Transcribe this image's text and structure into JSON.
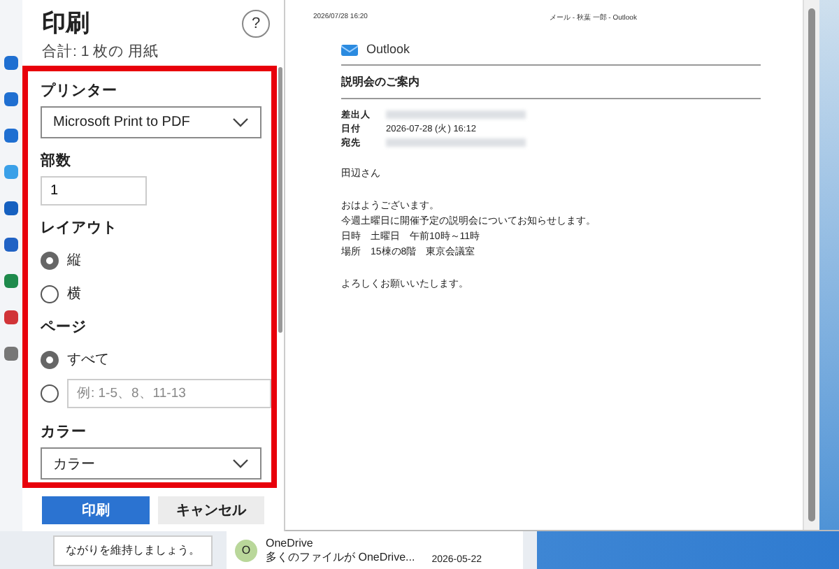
{
  "dialog": {
    "title": "印刷",
    "subtitle": "合計: 1 枚の 用紙",
    "help": "?"
  },
  "printer": {
    "label": "プリンター",
    "value": "Microsoft Print to PDF"
  },
  "copies": {
    "label": "部数",
    "value": "1"
  },
  "layout": {
    "label": "レイアウト",
    "options": [
      {
        "kind": "text",
        "label": "縦",
        "selected": true
      },
      {
        "kind": "text",
        "label": "横",
        "selected": false
      }
    ]
  },
  "pages": {
    "label": "ページ",
    "options": [
      {
        "kind": "text",
        "label": "すべて",
        "selected": true
      },
      {
        "kind": "range",
        "placeholder": "例: 1-5、8、11-13",
        "selected": false
      }
    ]
  },
  "color": {
    "label": "カラー",
    "value": "カラー"
  },
  "buttons": [
    {
      "label": "印刷",
      "kind": "primary"
    },
    {
      "label": "キャンセル",
      "kind": "secondary"
    }
  ],
  "preview": {
    "header_left": "2026/07/28 16:20",
    "header_center": "メール - 秋葉 一郎 - Outlook",
    "brand": "Outlook",
    "subject": "説明会のご案内",
    "fields": [
      {
        "label": "差出人",
        "kind": "redacted"
      },
      {
        "label": "日付",
        "kind": "text",
        "value": "2026-07-28 (火) 16:12"
      },
      {
        "label": "宛先",
        "kind": "redacted"
      }
    ],
    "body": [
      {
        "lines": [
          "田辺さん"
        ]
      },
      {
        "lines": [
          "おはようございます。",
          "今週土曜日に開催予定の説明会についてお知らせします。",
          "日時　土曜日　午前10時～11時",
          "場所　15棟の8階　東京会議室"
        ]
      },
      {
        "lines": [
          "よろしくお願いいたします。"
        ]
      }
    ]
  },
  "background": {
    "card_text": "ながりを維持しましょう。",
    "notification": {
      "avatar": "O",
      "sender": "OneDrive",
      "preview": "多くのファイルが OneDrive...",
      "date": "2026-05-22"
    }
  }
}
